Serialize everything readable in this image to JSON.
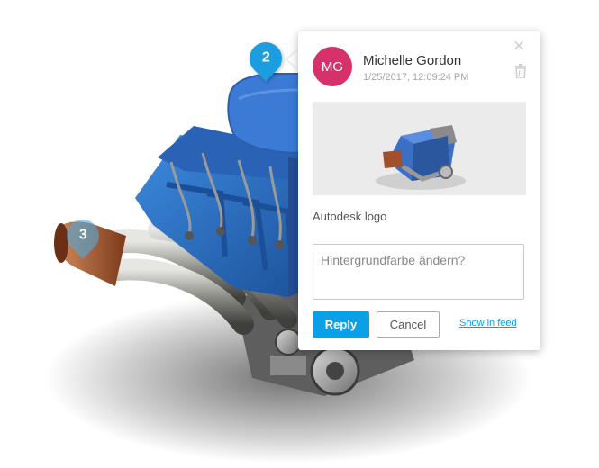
{
  "markers": [
    {
      "number": "2",
      "color": "#1a9ee0"
    },
    {
      "number": "3",
      "color": "#50aadc"
    }
  ],
  "comment": {
    "author_initials": "MG",
    "author_name": "Michelle Gordon",
    "timestamp": "1/25/2017, 12:09:24 PM",
    "avatar_color": "#d7316c",
    "attachment_caption": "Autodesk logo"
  },
  "reply": {
    "placeholder": "Hintergrundfarbe ändern?",
    "reply_label": "Reply",
    "cancel_label": "Cancel",
    "feed_link_label": "Show in feed"
  },
  "icons": {
    "close": "close-icon",
    "delete": "trash-icon"
  },
  "colors": {
    "accent": "#0aa0e6",
    "engine_blue": "#2f74c9",
    "exhaust_copper": "#a0512b"
  }
}
